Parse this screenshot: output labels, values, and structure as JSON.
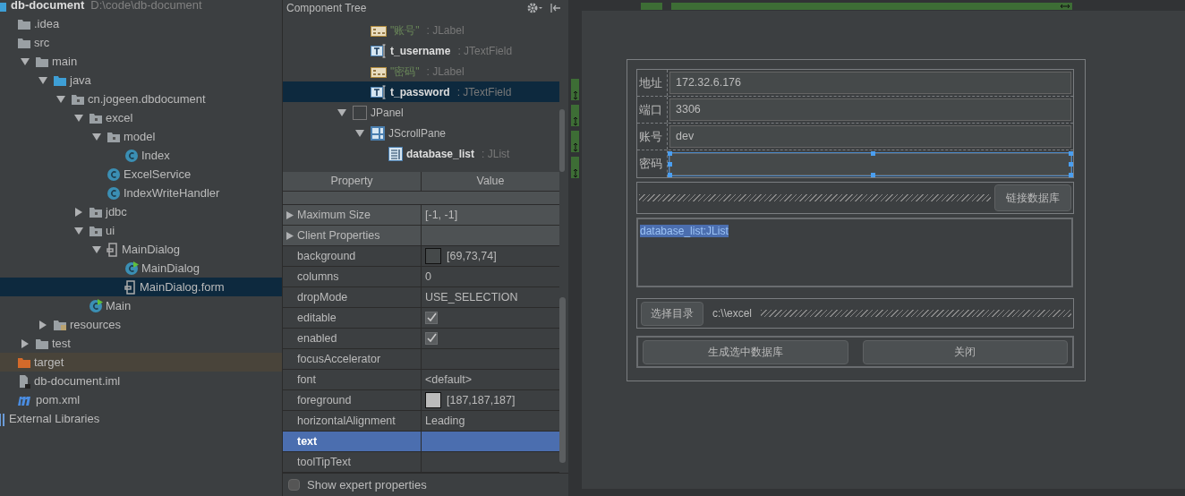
{
  "project_tree": {
    "items": [
      {
        "label": "db-document",
        "path": "D:\\code\\db-document",
        "kind": "module",
        "children": [
          {
            "label": ".idea",
            "kind": "folder"
          },
          {
            "label": "src",
            "kind": "folder",
            "children": [
              {
                "label": "main",
                "kind": "folder",
                "expanded": true,
                "children": [
                  {
                    "label": "java",
                    "kind": "source",
                    "expanded": true,
                    "children": [
                      {
                        "label": "cn.jogeen.dbdocument",
                        "kind": "package",
                        "expanded": true,
                        "children": [
                          {
                            "label": "excel",
                            "kind": "package",
                            "expanded": true,
                            "children": [
                              {
                                "label": "model",
                                "kind": "package",
                                "expanded": true,
                                "children": [
                                  {
                                    "label": "Index",
                                    "kind": "class",
                                    "selected": false
                                  }
                                ]
                              },
                              {
                                "label": "ExcelService",
                                "kind": "class",
                                "selected": false
                              },
                              {
                                "label": "IndexWriteHandler",
                                "kind": "class",
                                "selected": false
                              }
                            ]
                          },
                          {
                            "label": "jdbc",
                            "kind": "package",
                            "expanded": false
                          },
                          {
                            "label": "ui",
                            "kind": "package",
                            "expanded": true,
                            "children": [
                              {
                                "label": "MainDialog",
                                "kind": "form",
                                "expanded": true,
                                "children": [
                                  {
                                    "label": "MainDialog",
                                    "kind": "runclass",
                                    "selected": false
                                  },
                                  {
                                    "label": "MainDialog.form",
                                    "kind": "formfile",
                                    "selected": true
                                  }
                                ]
                              }
                            ]
                          },
                          {
                            "label": "Main",
                            "kind": "runclass",
                            "selected": false
                          }
                        ]
                      }
                    ]
                  },
                  {
                    "label": "resources",
                    "kind": "resources",
                    "expanded": false
                  }
                ]
              },
              {
                "label": "test",
                "kind": "folder",
                "expanded": false
              }
            ]
          },
          {
            "label": "target",
            "kind": "excluded"
          },
          {
            "label": "db-document.iml",
            "kind": "iml"
          },
          {
            "label": "pom.xml",
            "kind": "maven"
          }
        ]
      },
      {
        "label": "External Libraries",
        "kind": "library"
      }
    ]
  },
  "component_tree": {
    "title": "Component Tree",
    "items": [
      {
        "children": [
          {
            "kind": "label",
            "name": "\"账号\"",
            "type": ": JLabel",
            "selected": false
          },
          {
            "kind": "field",
            "name": "t_username",
            "type": ": JTextField",
            "selected": false
          },
          {
            "kind": "label",
            "name": "\"密码\"",
            "type": ": JLabel",
            "selected": false
          },
          {
            "kind": "field",
            "name": "t_password",
            "type": ": JTextField",
            "selected": true
          }
        ]
      },
      {
        "kind": "panel",
        "name": "JPanel",
        "expanded": true,
        "selected": false,
        "children": [
          {
            "kind": "scroll",
            "name": "JScrollPane",
            "expanded": true,
            "selected": false,
            "children": [
              {
                "kind": "list",
                "name": "database_list",
                "type": ": JList",
                "selected": false
              }
            ]
          }
        ]
      }
    ]
  },
  "properties": {
    "columns": [
      "Property",
      "Value"
    ],
    "rows": [
      {
        "kind": "group",
        "name": "Maximum Size",
        "value": "[-1, -1]",
        "selected": false
      },
      {
        "kind": "group",
        "name": "Client Properties",
        "selected": false
      },
      {
        "kind": "color",
        "name": "background",
        "value": "[69,73,74]",
        "color": "#45494a",
        "selected": false
      },
      {
        "kind": "text",
        "name": "columns",
        "value": "0",
        "selected": false
      },
      {
        "kind": "text",
        "name": "dropMode",
        "value": "USE_SELECTION",
        "selected": false
      },
      {
        "kind": "checkbox",
        "name": "editable",
        "checked": true,
        "selected": false
      },
      {
        "kind": "checkbox",
        "name": "enabled",
        "checked": true,
        "selected": false
      },
      {
        "kind": "text",
        "name": "focusAccelerator",
        "selected": false
      },
      {
        "kind": "text",
        "name": "font",
        "value": "<default>",
        "selected": false
      },
      {
        "kind": "color",
        "name": "foreground",
        "value": "[187,187,187]",
        "color": "#bbbbbb",
        "selected": false
      },
      {
        "kind": "text",
        "name": "horizontalAlignment",
        "value": "Leading",
        "selected": false
      },
      {
        "kind": "text",
        "name": "text",
        "selected": true
      },
      {
        "kind": "text",
        "name": "toolTipText",
        "selected": false
      }
    ],
    "show_expert": {
      "label": "Show expert properties",
      "checked": false
    }
  },
  "form": {
    "fields": [
      {
        "label": "地址",
        "value": "172.32.6.176",
        "selected": false
      },
      {
        "label": "端口",
        "value": "3306",
        "selected": false
      },
      {
        "label": "账号",
        "value": "dev",
        "selected": false
      },
      {
        "label": "密码",
        "selected": true
      }
    ],
    "connect_button": "链接数据库",
    "list_text": "database_list:JList",
    "choose_dir_button": "选择目录",
    "path": "c:\\\\excel",
    "buttons": [
      "生成选中数据库",
      "关闭"
    ]
  }
}
